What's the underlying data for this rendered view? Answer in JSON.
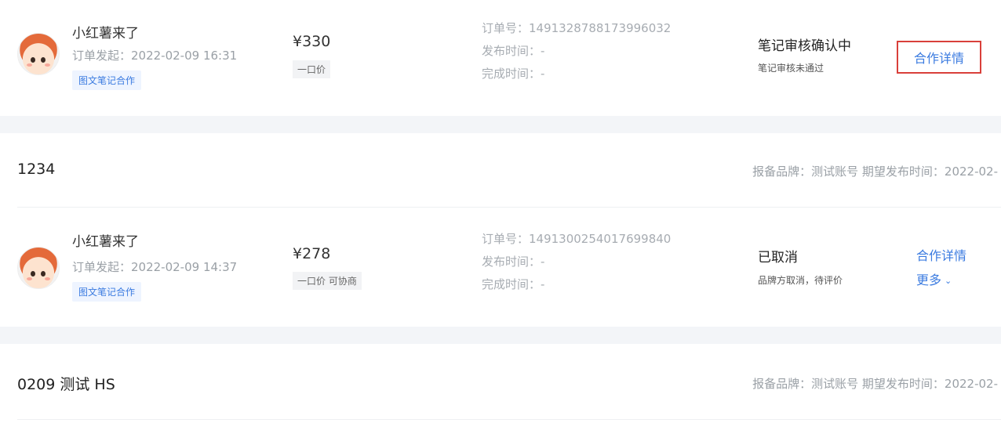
{
  "orders": [
    {
      "creator_name": "小红薯来了",
      "initiated": "订单发起：2022-02-09 16:31",
      "type_tag": "图文笔记合作",
      "price": "¥330",
      "price_tag": "一口价",
      "order_no": "订单号：1491328788173996032",
      "publish_time": "发布时间：-",
      "complete_time": "完成时间：-",
      "status": "笔记审核确认中",
      "sub_status": "笔记审核未通过",
      "detail_link": "合作详情"
    },
    {
      "creator_name": "小红薯来了",
      "initiated": "订单发起：2022-02-09 14:37",
      "type_tag": "图文笔记合作",
      "price": "¥278",
      "price_tag": "一口价 可协商",
      "order_no": "订单号：1491300254017699840",
      "publish_time": "发布时间：-",
      "complete_time": "完成时间：-",
      "status": "已取消",
      "sub_status": "品牌方取消，待评价",
      "detail_link": "合作详情",
      "more_link": "更多"
    }
  ],
  "groups": [
    {
      "title": "1234",
      "meta": "报备品牌：测试账号  期望发布时间：2022-02-"
    },
    {
      "title": "0209 测试 HS",
      "meta": "报备品牌：测试账号  期望发布时间：2022-02-"
    }
  ],
  "colors": {
    "accent": "#3b7be0",
    "highlight_border": "#d9403a",
    "section_bg": "#f3f5f8"
  }
}
